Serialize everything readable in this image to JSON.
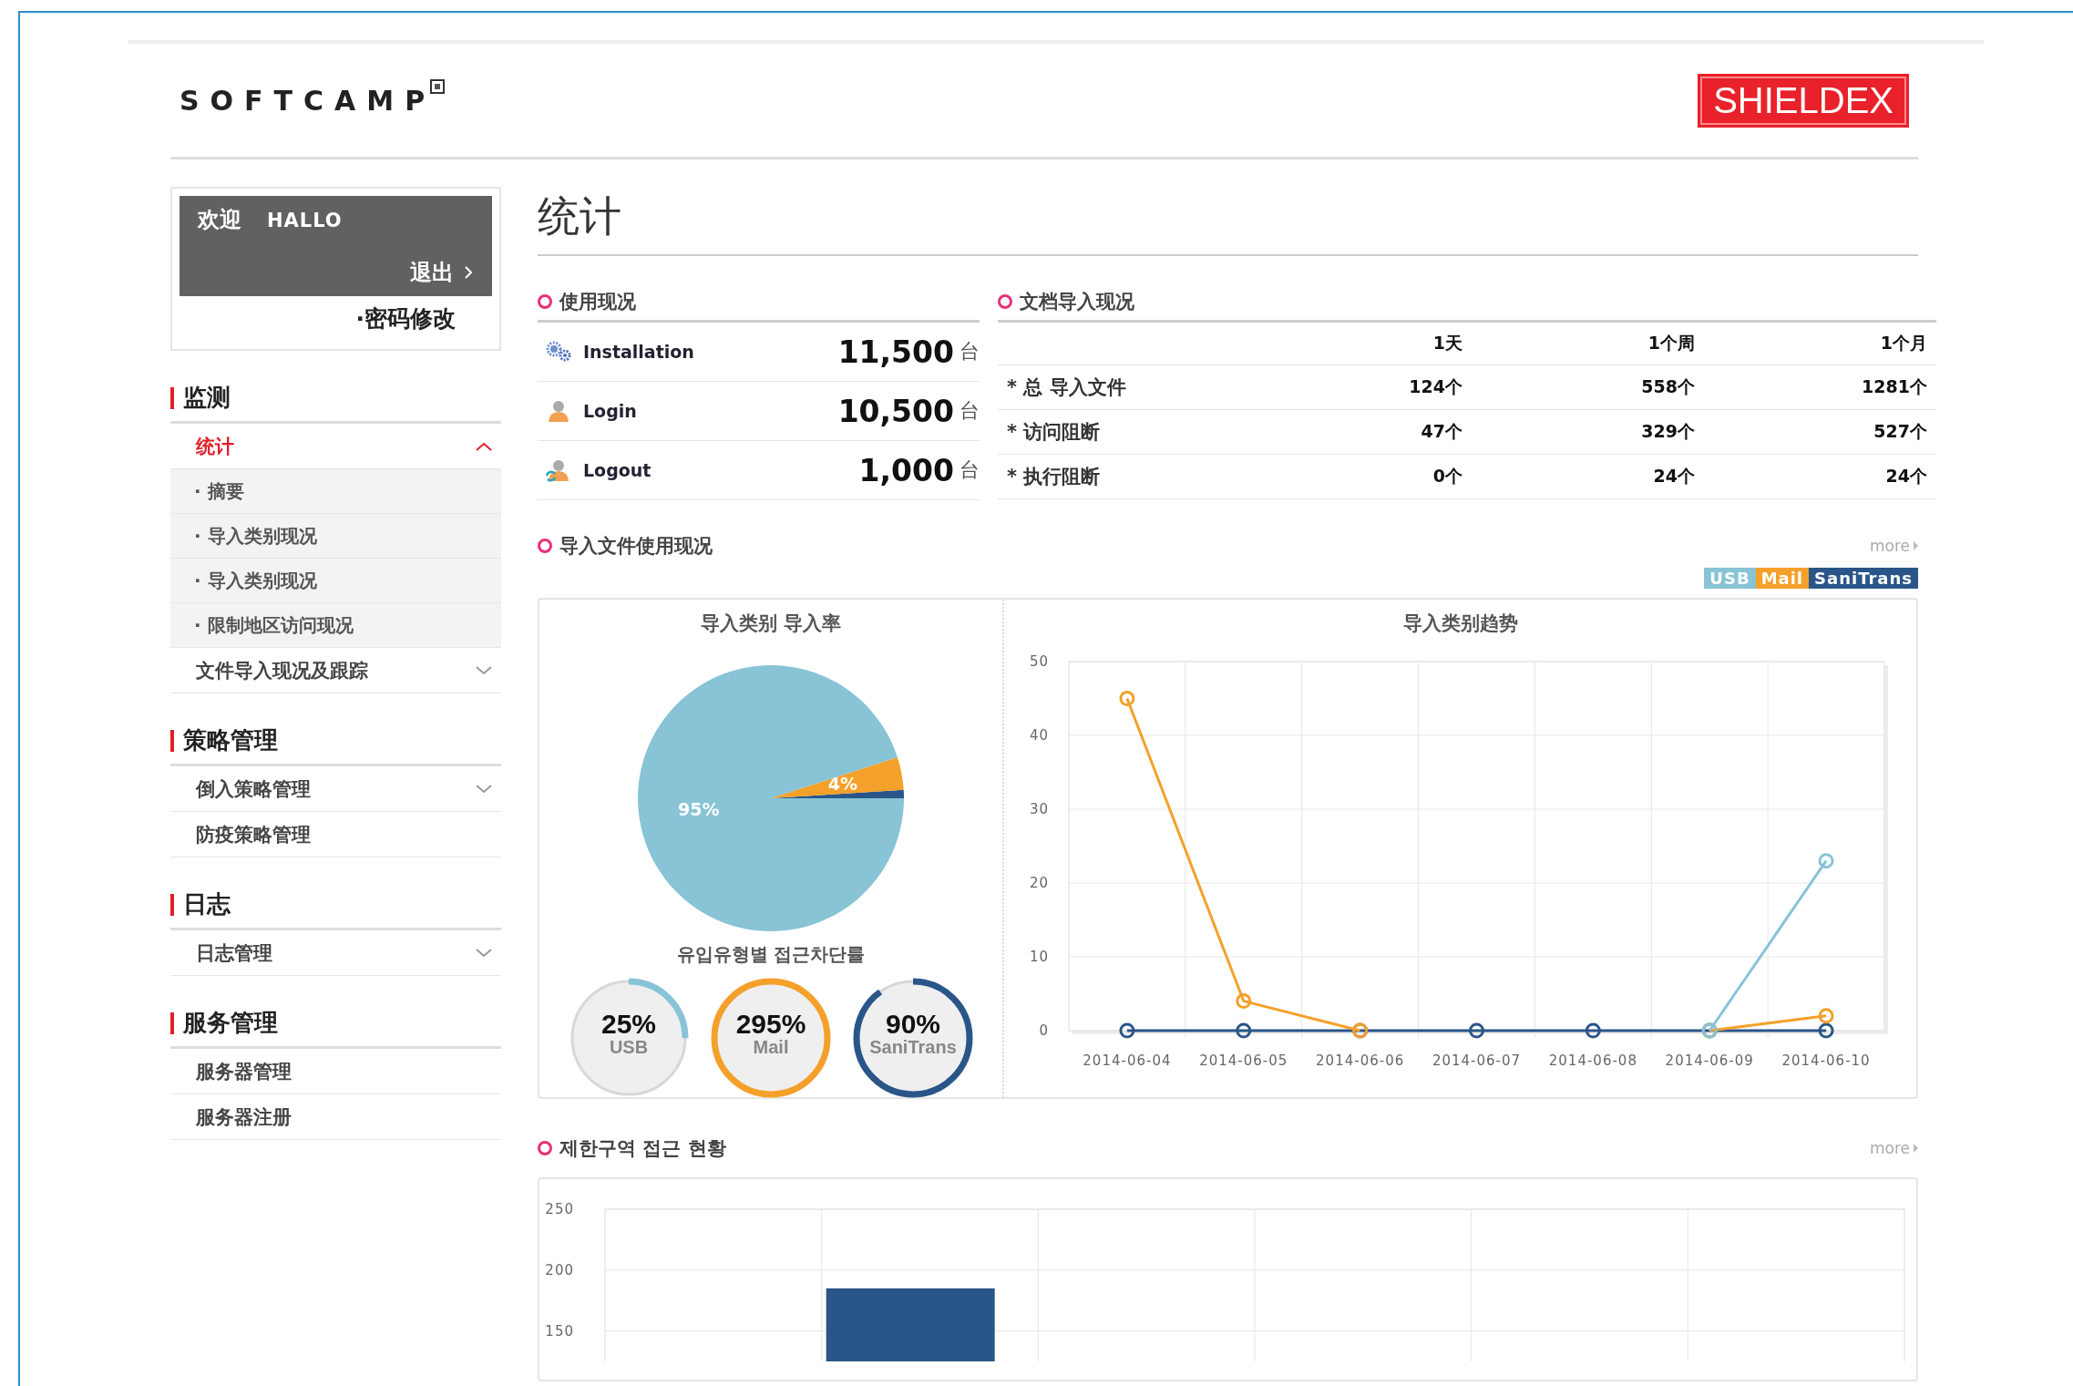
{
  "header": {
    "logo": "SOFTCAMP",
    "brand": "SHIELDEX"
  },
  "user_panel": {
    "greeting": "欢迎",
    "user": "HALLO",
    "logout": "退出",
    "change_password": "·密码修改"
  },
  "sidebar": {
    "sections": [
      {
        "title": "监测",
        "items": [
          {
            "kind": "group",
            "label": "统计",
            "selected": true,
            "expanded": true,
            "children": [
              {
                "label": "· 摘要",
                "selected": false
              },
              {
                "label": "· 导入类别现况",
                "selected": false
              },
              {
                "label": "· 导入类别现况",
                "selected": false
              },
              {
                "label": "· 限制地区访问现况",
                "selected": false
              }
            ]
          },
          {
            "kind": "group",
            "label": "文件导入现况及跟踪",
            "selected": false,
            "expanded": false
          }
        ]
      },
      {
        "title": "策略管理",
        "items": [
          {
            "kind": "group",
            "label": "倒入策略管理",
            "selected": false,
            "expanded": false
          },
          {
            "kind": "link",
            "label": "防疫策略管理",
            "selected": false
          }
        ]
      },
      {
        "title": "日志",
        "items": [
          {
            "kind": "group",
            "label": "日志管理",
            "selected": false,
            "expanded": false
          }
        ]
      },
      {
        "title": "服务管理",
        "items": [
          {
            "kind": "link",
            "label": "服务器管理",
            "selected": false
          },
          {
            "kind": "link",
            "label": "服务器注册",
            "selected": false
          }
        ]
      }
    ]
  },
  "page_title": "统计",
  "usage": {
    "title": "使用现况",
    "rows": [
      {
        "kind": "installation",
        "label": "Installation",
        "value": "11,500",
        "unit": "台"
      },
      {
        "kind": "login",
        "label": "Login",
        "value": "10,500",
        "unit": "台"
      },
      {
        "kind": "logout",
        "label": "Logout",
        "value": "1,000",
        "unit": "台"
      }
    ]
  },
  "imports": {
    "title": "文档导入现况",
    "columns": [
      "1天",
      "1个周",
      "1个月"
    ],
    "rows": [
      {
        "label": "* 总  导入文件",
        "values": [
          "124个",
          "558个",
          "1281个"
        ]
      },
      {
        "label": "* 访问阻断",
        "values": [
          "47个",
          "329个",
          "527个"
        ]
      },
      {
        "label": "* 执行阻断",
        "values": [
          "0个",
          "24个",
          "24个"
        ]
      }
    ]
  },
  "file_usage": {
    "title": "导入文件使用现况",
    "more": "more",
    "pie": {
      "chart_data": {
        "type": "pie",
        "title": "导入类别 导入率",
        "values": [
          95,
          4,
          1
        ],
        "value_labels": [
          "95%",
          "4%",
          null
        ]
      }
    },
    "gauges_title": "유입유형별 접근차단률",
    "gauges": [
      {
        "value": "25%",
        "label": "USB",
        "level": 0.25,
        "color": "#88c3d6"
      },
      {
        "value": "295%",
        "label": "Mail",
        "level": 1,
        "color": "#f5a02a"
      },
      {
        "value": "90%",
        "label": "SaniTrans",
        "level": 0.9,
        "color": "#2a5589"
      }
    ],
    "trend": {
      "chart_data": {
        "type": "line",
        "title": "导入类别趋势",
        "categories": [
          "2014-06-04",
          "2014-06-05",
          "2014-06-06",
          "2014-06-07",
          "2014-06-08",
          "2014-06-09",
          "2014-06-10"
        ],
        "ylim": [
          0,
          50
        ],
        "yticks": [
          0,
          10,
          20,
          30,
          40,
          50
        ],
        "grid": true,
        "series": [
          {
            "name": "USB",
            "color": "#88c3d6",
            "marker": "circle",
            "values": [
              null,
              null,
              null,
              null,
              null,
              0,
              23
            ]
          },
          {
            "name": "Mail",
            "color": "#f5a02a",
            "marker": "circle",
            "values": [
              45,
              4,
              0,
              null,
              null,
              0,
              2
            ]
          },
          {
            "name": "SaniTrans",
            "color": "#2a5589",
            "marker": "circle",
            "values": [
              0,
              0,
              0,
              0,
              0,
              0,
              0
            ]
          }
        ]
      }
    }
  },
  "restricted": {
    "title": "제한구역 접근 현황",
    "more": "more",
    "chart_data": {
      "type": "bar",
      "values": [
        null,
        185,
        null,
        null,
        null,
        null
      ],
      "ylim": [
        125,
        250
      ],
      "yticks": [
        150,
        200,
        250
      ],
      "grid": true
    }
  }
}
